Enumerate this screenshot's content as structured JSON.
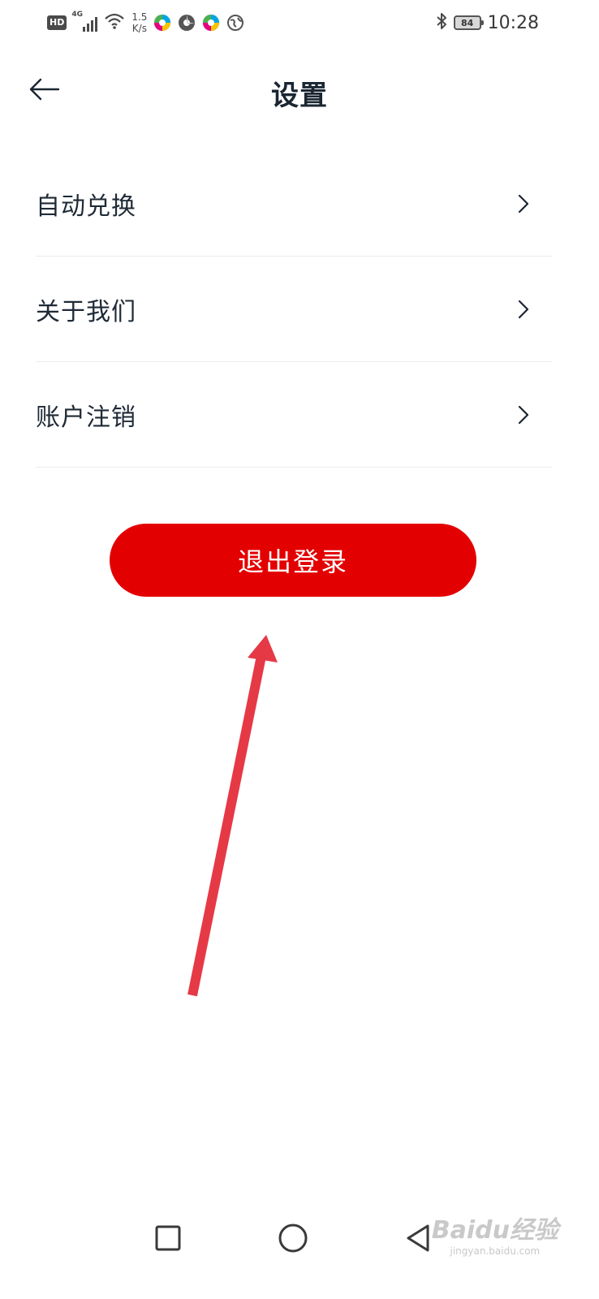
{
  "status_bar": {
    "hd": "HD",
    "network": "4G",
    "speed_value": "1.5",
    "speed_unit": "K/s",
    "battery": "84",
    "time": "10:28",
    "icons": [
      "hd-icon",
      "signal-icon",
      "wifi-icon",
      "app-icon",
      "app-icon",
      "app-icon",
      "globe-icon",
      "bluetooth-icon",
      "battery-icon"
    ]
  },
  "header": {
    "title": "设置",
    "back_icon": "back-arrow-icon"
  },
  "menu": {
    "items": [
      {
        "label": "自动兑换",
        "icon": "chevron-right-icon"
      },
      {
        "label": "关于我们",
        "icon": "chevron-right-icon"
      },
      {
        "label": "账户注销",
        "icon": "chevron-right-icon"
      }
    ]
  },
  "logout": {
    "label": "退出登录",
    "color": "#e30000"
  },
  "annotation": {
    "arrow_color": "#e63946"
  },
  "nav_bar": {
    "icons": [
      "recent-apps-icon",
      "home-icon",
      "back-icon"
    ]
  },
  "watermark": {
    "brand": "Baidu经验",
    "url": "jingyan.baidu.com"
  }
}
